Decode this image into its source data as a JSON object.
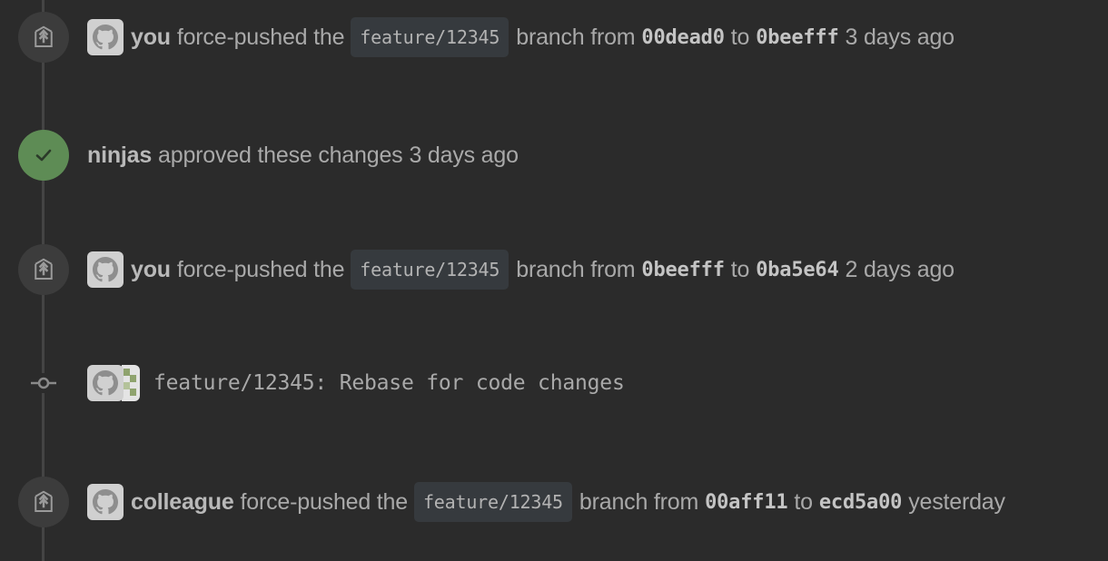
{
  "timeline": {
    "events": [
      {
        "type": "force-push",
        "icon": "force-push-icon",
        "user": "you",
        "action": "force-pushed the",
        "branch": "feature/12345",
        "from_word": "branch from",
        "from_sha": "00dead0",
        "to_word": "to",
        "to_sha": "0beefff",
        "time": "3 days ago"
      },
      {
        "type": "review",
        "icon": "checkmark-icon",
        "user": "ninjas",
        "action": "approved these changes",
        "time": "3 days ago",
        "color": "#5e8c55"
      },
      {
        "type": "force-push",
        "icon": "force-push-icon",
        "user": "you",
        "action": "force-pushed the",
        "branch": "feature/12345",
        "from_word": "branch from",
        "from_sha": "0beefff",
        "to_word": "to",
        "to_sha": "0ba5e64",
        "time": "2 days ago"
      },
      {
        "type": "commit",
        "icon": "commit-icon",
        "message": "feature/12345: Rebase for code changes"
      },
      {
        "type": "force-push",
        "icon": "force-push-icon",
        "user": "colleague",
        "action": "force-pushed the",
        "branch": "feature/12345",
        "from_word": "branch from",
        "from_sha": "00aff11",
        "to_word": "to",
        "to_sha": "ecd5a00",
        "time": "yesterday"
      }
    ]
  },
  "colors": {
    "background": "#2b2b2b",
    "approved": "#5e8c55",
    "node": "#3c3c3c",
    "chip": "#363a3e"
  }
}
